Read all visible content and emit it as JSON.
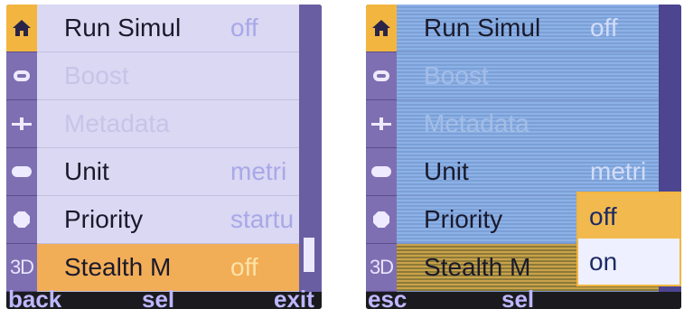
{
  "left_screen": {
    "menu": [
      {
        "label": "Run Simul",
        "value": "off",
        "state": "normal"
      },
      {
        "label": "Boost",
        "value": "",
        "state": "disabled"
      },
      {
        "label": "Metadata",
        "value": "",
        "state": "disabled"
      },
      {
        "label": "Unit",
        "value": "metri",
        "state": "normal"
      },
      {
        "label": "Priority",
        "value": "startu",
        "state": "normal"
      },
      {
        "label": "Stealth M",
        "value": "off",
        "state": "selected"
      }
    ],
    "softkeys": {
      "left": "back",
      "center": "sel",
      "right": "exit"
    }
  },
  "right_screen": {
    "menu": [
      {
        "label": "Run Simul",
        "value": "off",
        "state": "normal"
      },
      {
        "label": "Boost",
        "value": "",
        "state": "disabled"
      },
      {
        "label": "Metadata",
        "value": "",
        "state": "disabled"
      },
      {
        "label": "Unit",
        "value": "metri",
        "state": "normal"
      },
      {
        "label": "Priority",
        "value": "",
        "state": "normal"
      },
      {
        "label": "Stealth M",
        "value": "",
        "state": "selected"
      }
    ],
    "dropdown_options": [
      "off",
      "on"
    ],
    "dropdown_selected": "off",
    "softkeys": {
      "left": "esc",
      "center": "sel",
      "right": ""
    }
  },
  "icons": [
    "home-icon",
    "ring-icon",
    "slider-icon",
    "pill-icon",
    "octagon-icon",
    "3D"
  ],
  "colors": {
    "selection": "#f2b640",
    "sidebar": "#7e6fb2",
    "menu_bg_left": "#dad8f2",
    "menu_bg_right": "#8cb2e8",
    "softkey_text": "#bdb8ff"
  }
}
